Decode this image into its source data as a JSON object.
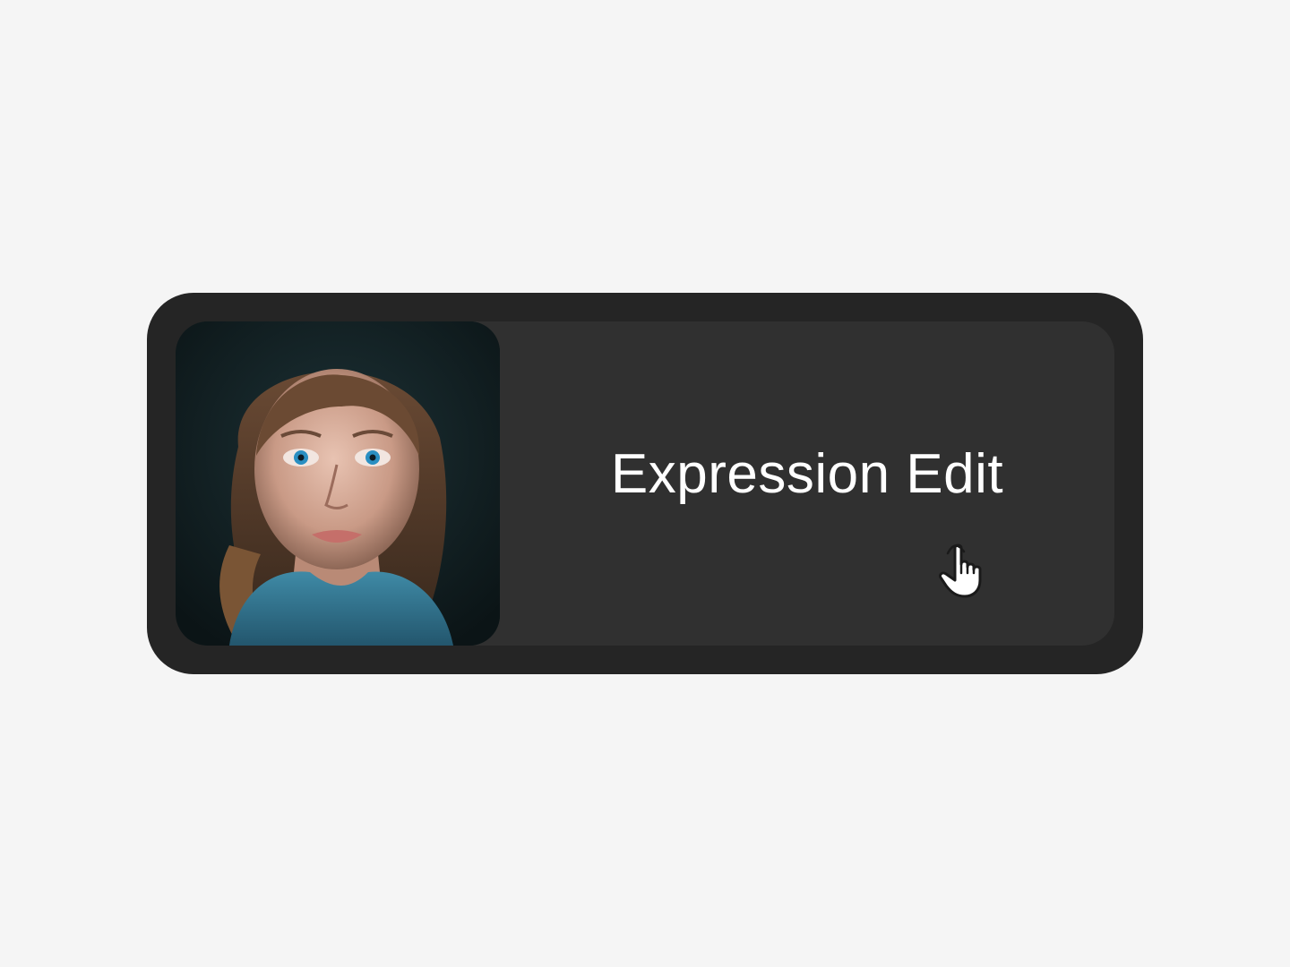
{
  "button": {
    "label": "Expression Edit",
    "thumbnail_icon": "portrait-thumbnail"
  },
  "pointer": {
    "icon": "hand-pointer-icon"
  },
  "colors": {
    "background": "#f5f5f5",
    "card_outer": "#252525",
    "card_inner": "#303030",
    "text": "#ffffff"
  }
}
